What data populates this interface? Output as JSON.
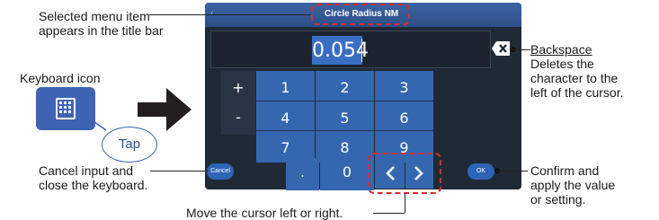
{
  "device": {
    "title": "Circle Radius NM",
    "value": "0.054",
    "keys": {
      "plus": "+",
      "minus": "-",
      "dot": ".",
      "digits": [
        "1",
        "2",
        "3",
        "4",
        "5",
        "6",
        "7",
        "8",
        "9",
        "0"
      ]
    },
    "cancel_label": "Cancel",
    "ok_label": "OK"
  },
  "annotations": {
    "title_bar": [
      "Selected menu item",
      "appears in the title bar"
    ],
    "keyboard_icon": "Keyboard icon",
    "tap": "Tap",
    "backspace_title": "Backspace",
    "backspace_desc": [
      "Deletes the",
      "character to the",
      "left of the cursor."
    ],
    "cancel": [
      "Cancel input and",
      "close the keyboard."
    ],
    "confirm": [
      "Confirm and",
      "apply the value",
      "or setting."
    ],
    "cursor_move": "Move the cursor left or right."
  },
  "colors": {
    "panel": "#202a36",
    "key_blue": "#3567b0",
    "title_blue": "#3b63a3",
    "highlight_dash": "#d32f2f"
  }
}
